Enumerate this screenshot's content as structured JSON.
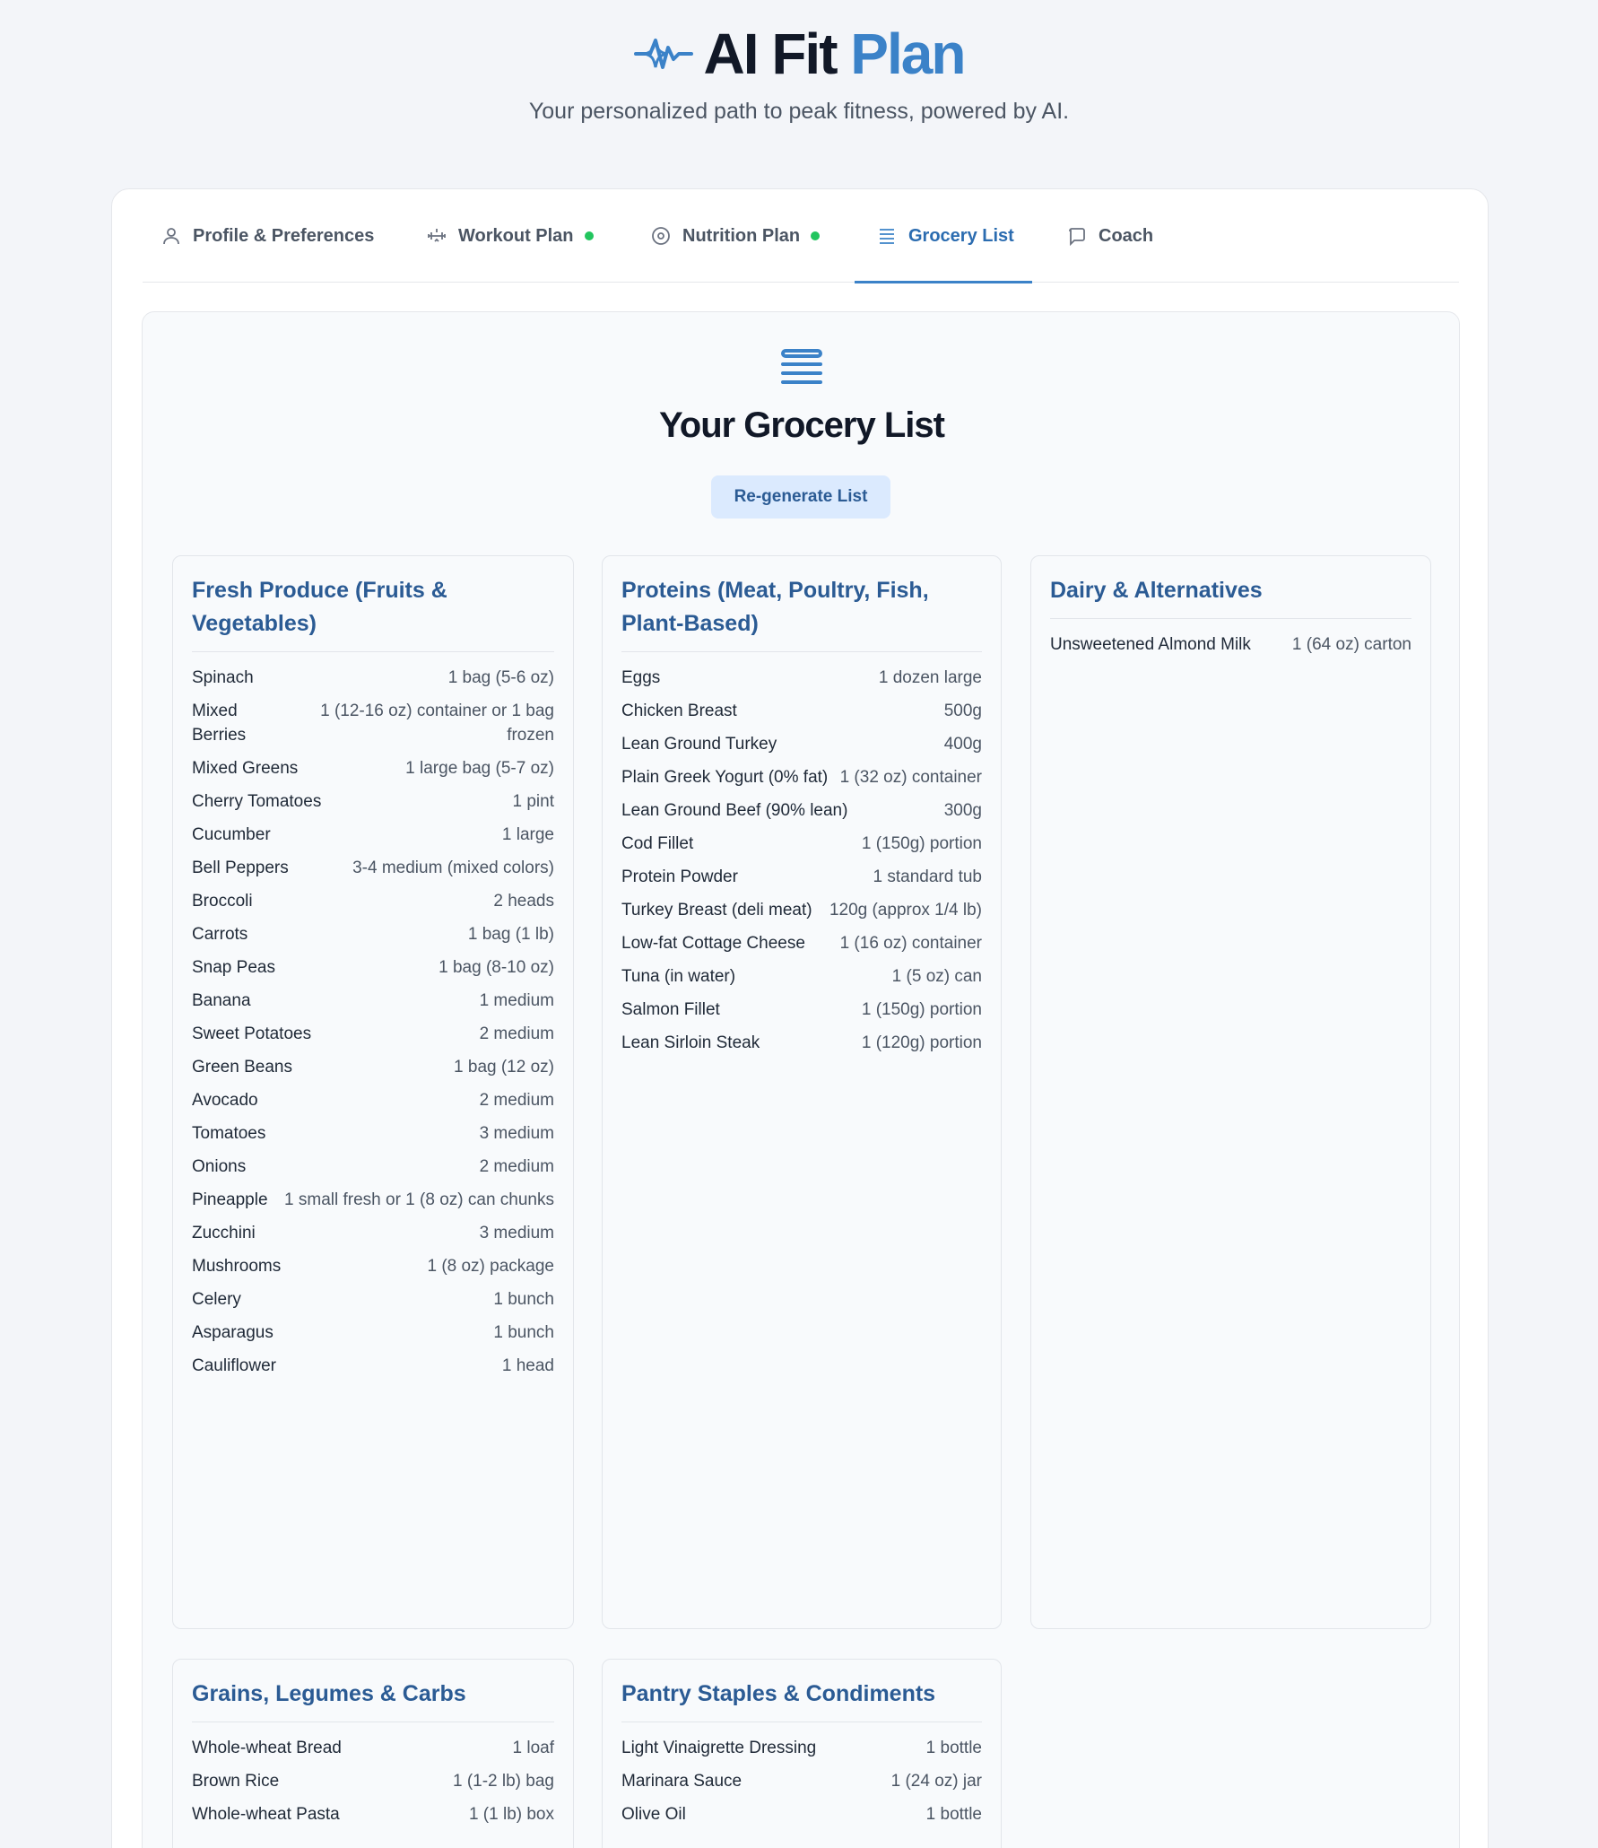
{
  "brand": {
    "name_main": "AI Fit",
    "name_accent": "Plan",
    "subtitle": "Your personalized path to peak fitness, powered by AI."
  },
  "tabs": [
    {
      "label": "Profile & Preferences",
      "icon": "user-icon",
      "status_dot": false,
      "active": false
    },
    {
      "label": "Workout Plan",
      "icon": "dumbbell-icon",
      "status_dot": true,
      "active": false
    },
    {
      "label": "Nutrition Plan",
      "icon": "plate-icon",
      "status_dot": true,
      "active": false
    },
    {
      "label": "Grocery List",
      "icon": "list-icon",
      "status_dot": false,
      "active": true
    },
    {
      "label": "Coach",
      "icon": "chat-icon",
      "status_dot": false,
      "active": false
    }
  ],
  "colors": {
    "accent": "#3b82c8",
    "status_dot": "#22c55e",
    "category_title": "#2b5b94"
  },
  "grocery": {
    "title": "Your Grocery List",
    "regenerate_label": "Re-generate List",
    "categories": [
      {
        "title": "Fresh Produce (Fruits & Vegetables)",
        "items": [
          {
            "name": "Spinach",
            "qty": "1 bag (5-6 oz)"
          },
          {
            "name": "Mixed Berries",
            "qty": "1 (12-16 oz) container or 1 bag frozen"
          },
          {
            "name": "Mixed Greens",
            "qty": "1 large bag (5-7 oz)"
          },
          {
            "name": "Cherry Tomatoes",
            "qty": "1 pint"
          },
          {
            "name": "Cucumber",
            "qty": "1 large"
          },
          {
            "name": "Bell Peppers",
            "qty": "3-4 medium (mixed colors)"
          },
          {
            "name": "Broccoli",
            "qty": "2 heads"
          },
          {
            "name": "Carrots",
            "qty": "1 bag (1 lb)"
          },
          {
            "name": "Snap Peas",
            "qty": "1 bag (8-10 oz)"
          },
          {
            "name": "Banana",
            "qty": "1 medium"
          },
          {
            "name": "Sweet Potatoes",
            "qty": "2 medium"
          },
          {
            "name": "Green Beans",
            "qty": "1 bag (12 oz)"
          },
          {
            "name": "Avocado",
            "qty": "2 medium"
          },
          {
            "name": "Tomatoes",
            "qty": "3 medium"
          },
          {
            "name": "Onions",
            "qty": "2 medium"
          },
          {
            "name": "Pineapple",
            "qty": "1 small fresh or 1 (8 oz) can chunks"
          },
          {
            "name": "Zucchini",
            "qty": "3 medium"
          },
          {
            "name": "Mushrooms",
            "qty": "1 (8 oz) package"
          },
          {
            "name": "Celery",
            "qty": "1 bunch"
          },
          {
            "name": "Asparagus",
            "qty": "1 bunch"
          },
          {
            "name": "Cauliflower",
            "qty": "1 head"
          }
        ]
      },
      {
        "title": "Proteins (Meat, Poultry, Fish, Plant-Based)",
        "items": [
          {
            "name": "Eggs",
            "qty": "1 dozen large"
          },
          {
            "name": "Chicken Breast",
            "qty": "500g"
          },
          {
            "name": "Lean Ground Turkey",
            "qty": "400g"
          },
          {
            "name": "Plain Greek Yogurt (0% fat)",
            "qty": "1 (32 oz) container"
          },
          {
            "name": "Lean Ground Beef (90% lean)",
            "qty": "300g"
          },
          {
            "name": "Cod Fillet",
            "qty": "1 (150g) portion"
          },
          {
            "name": "Protein Powder",
            "qty": "1 standard tub"
          },
          {
            "name": "Turkey Breast (deli meat)",
            "qty": "120g (approx 1/4 lb)"
          },
          {
            "name": "Low-fat Cottage Cheese",
            "qty": "1 (16 oz) container"
          },
          {
            "name": "Tuna (in water)",
            "qty": "1 (5 oz) can"
          },
          {
            "name": "Salmon Fillet",
            "qty": "1 (150g) portion"
          },
          {
            "name": "Lean Sirloin Steak",
            "qty": "1 (120g) portion"
          }
        ]
      },
      {
        "title": "Dairy & Alternatives",
        "items": [
          {
            "name": "Unsweetened Almond Milk",
            "qty": "1 (64 oz) carton"
          }
        ]
      },
      {
        "title": "Grains, Legumes & Carbs",
        "items": [
          {
            "name": "Whole-wheat Bread",
            "qty": "1 loaf"
          },
          {
            "name": "Brown Rice",
            "qty": "1 (1-2 lb) bag"
          },
          {
            "name": "Whole-wheat Pasta",
            "qty": "1 (1 lb) box"
          }
        ]
      },
      {
        "title": "Pantry Staples & Condiments",
        "items": [
          {
            "name": "Light Vinaigrette Dressing",
            "qty": "1 bottle"
          },
          {
            "name": "Marinara Sauce",
            "qty": "1 (24 oz) jar"
          },
          {
            "name": "Olive Oil",
            "qty": "1 bottle"
          }
        ]
      }
    ]
  }
}
